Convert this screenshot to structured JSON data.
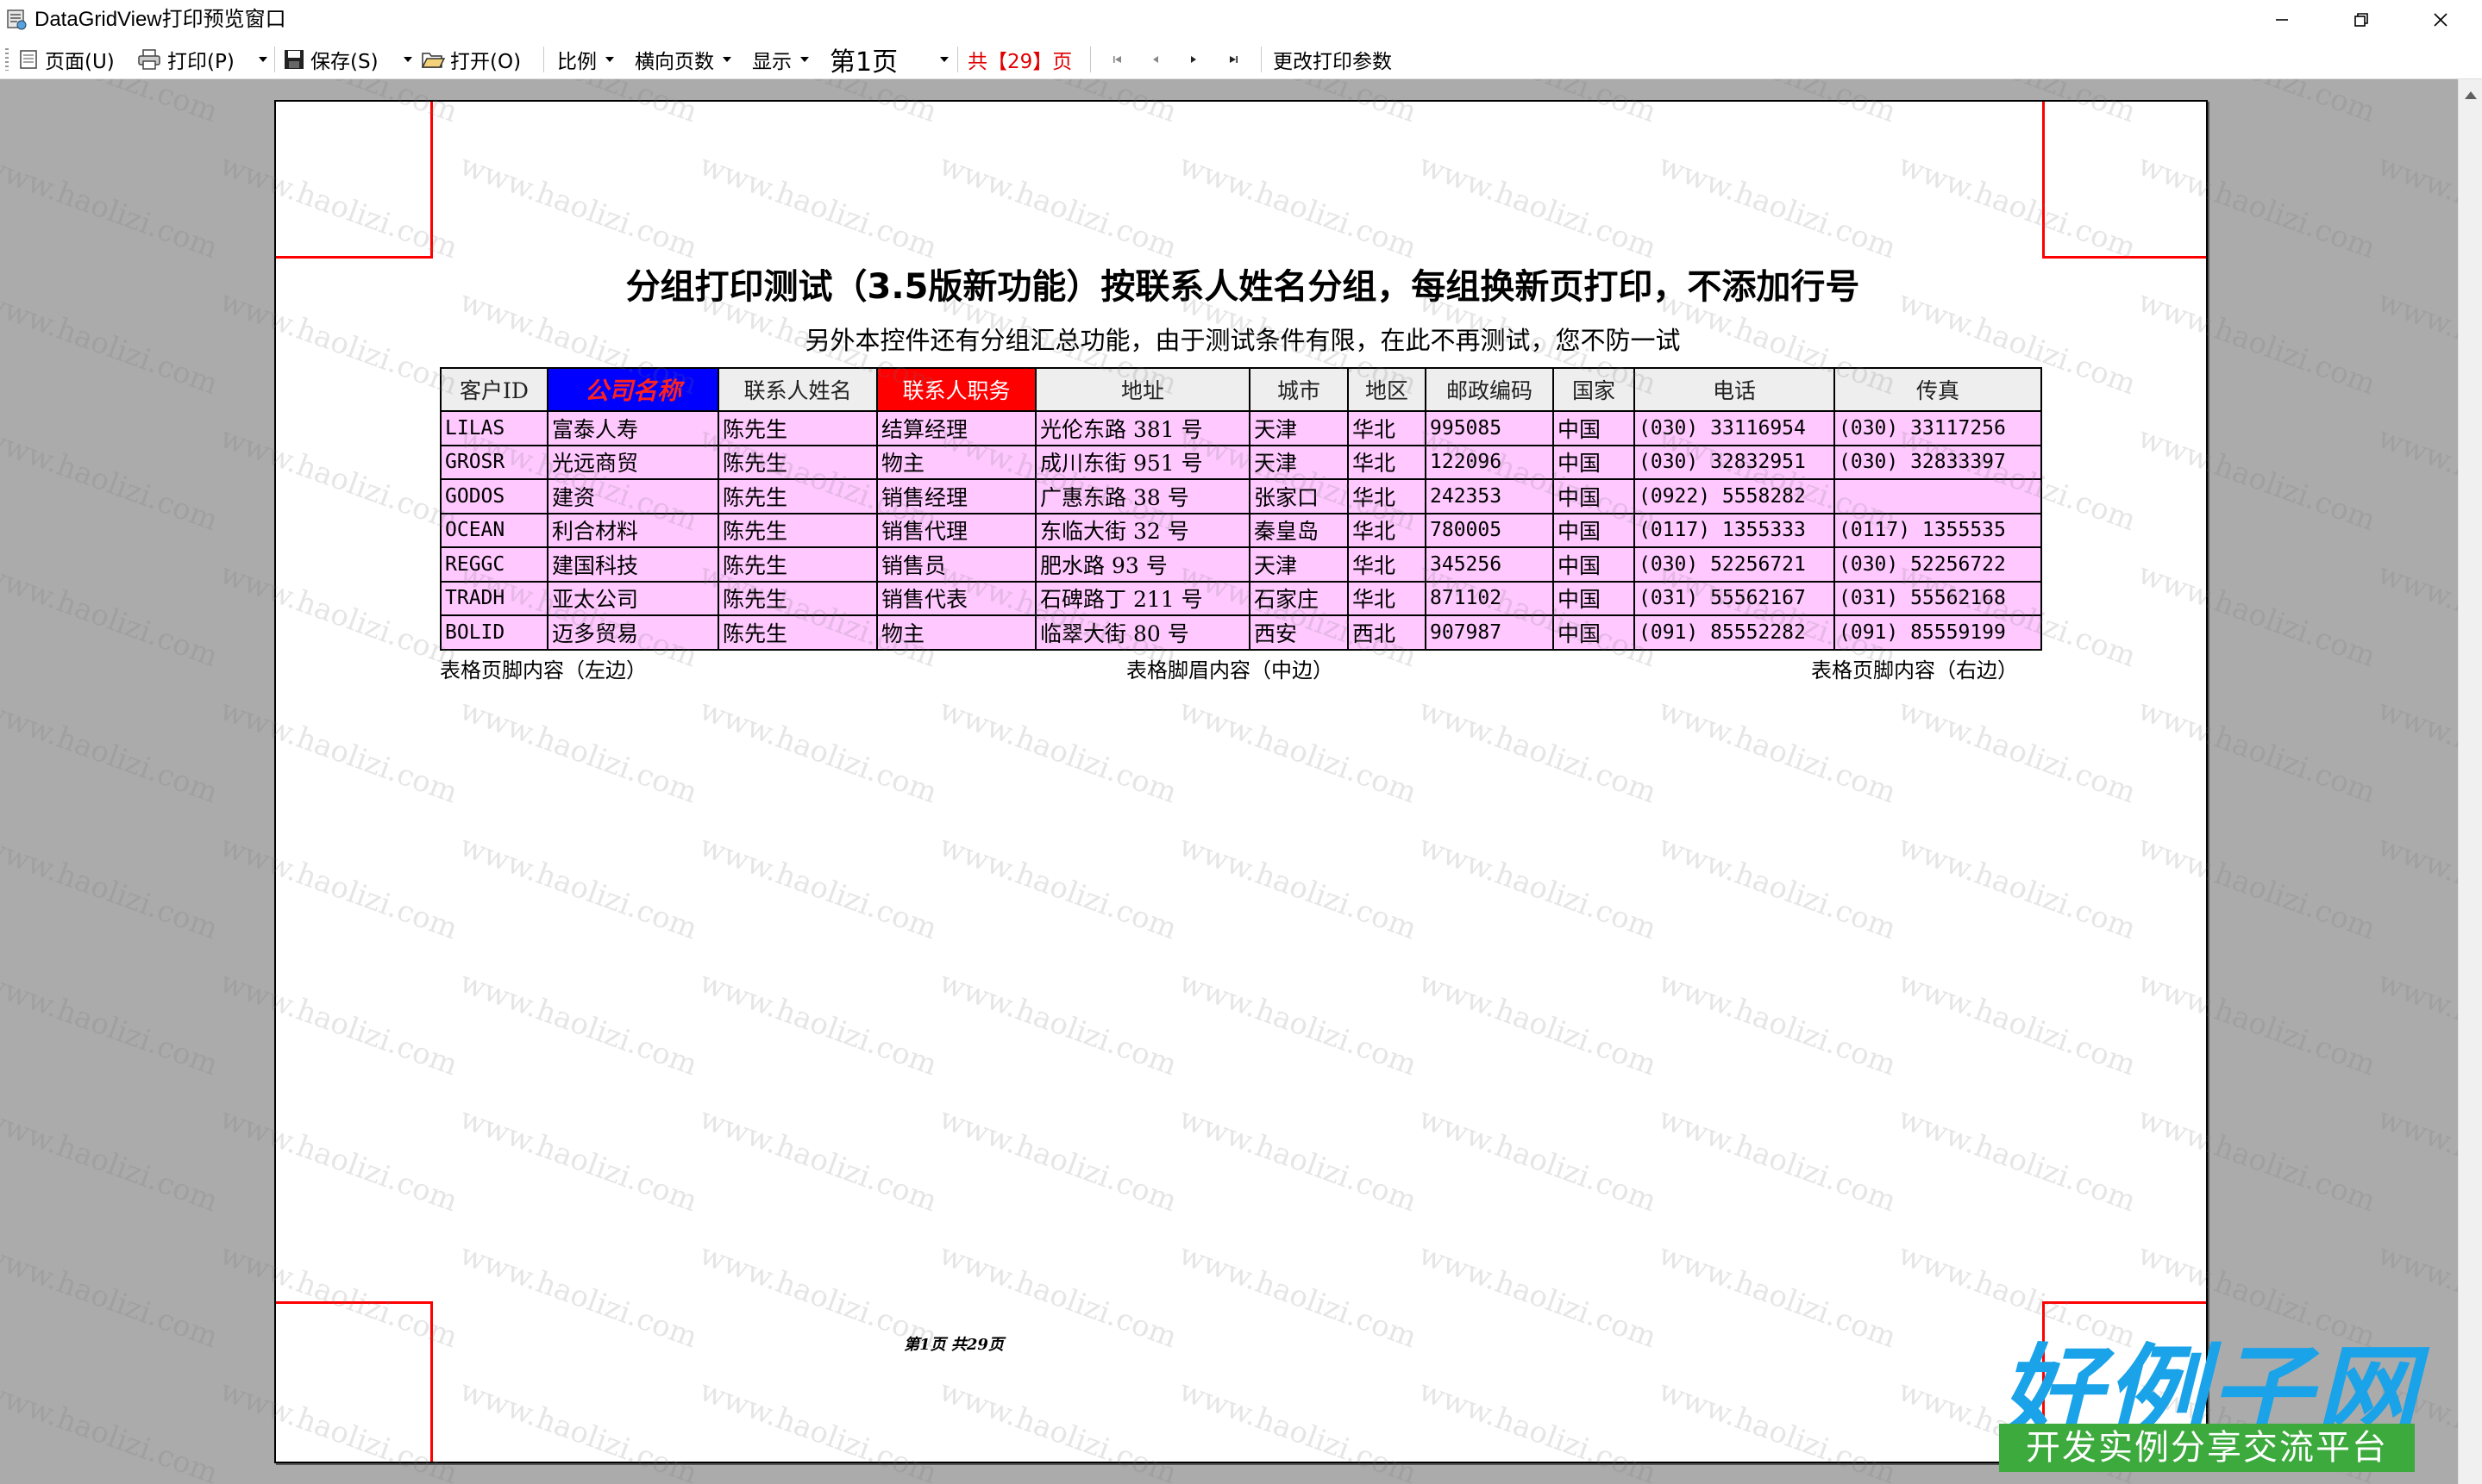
{
  "window": {
    "title": "DataGridView打印预览窗口"
  },
  "toolbar": {
    "page_setup": "页面(U)",
    "print": "打印(P)",
    "save": "保存(S)",
    "open": "打开(O)",
    "scale": "比例",
    "horizontal_pages": "横向页数",
    "display": "显示",
    "current_page": "第1页",
    "total_pages": "共【29】页",
    "change_params": "更改打印参数"
  },
  "report": {
    "title": "分组打印测试（3.5版新功能）按联系人姓名分组，每组换新页打印，不添加行号",
    "subtitle": "另外本控件还有分组汇总功能，由于测试条件有限，在此不再测试，您不防一试",
    "columns": [
      "客户ID",
      "公司名称",
      "联系人姓名",
      "联系人职务",
      "地址",
      "城市",
      "地区",
      "邮政编码",
      "国家",
      "电话",
      "传真"
    ],
    "rows": [
      [
        "LILAS",
        "富泰人寿",
        "陈先生",
        "结算经理",
        "光伦东路 381 号",
        "天津",
        "华北",
        "995085",
        "中国",
        "(030) 33116954",
        "(030) 33117256"
      ],
      [
        "GROSR",
        "光远商贸",
        "陈先生",
        "物主",
        "成川东街 951 号",
        "天津",
        "华北",
        "122096",
        "中国",
        "(030) 32832951",
        "(030) 32833397"
      ],
      [
        "GODOS",
        "建资",
        "陈先生",
        "销售经理",
        "广惠东路 38 号",
        "张家口",
        "华北",
        "242353",
        "中国",
        "(0922) 5558282",
        ""
      ],
      [
        "OCEAN",
        "利合材料",
        "陈先生",
        "销售代理",
        "东临大街 32 号",
        "秦皇岛",
        "华北",
        "780005",
        "中国",
        "(0117) 1355333",
        "(0117) 1355535"
      ],
      [
        "REGGC",
        "建国科技",
        "陈先生",
        "销售员",
        "肥水路 93 号",
        "天津",
        "华北",
        "345256",
        "中国",
        "(030) 52256721",
        "(030) 52256722"
      ],
      [
        "TRADH",
        "亚太公司",
        "陈先生",
        "销售代表",
        "石碑路丁 211 号",
        "石家庄",
        "华北",
        "871102",
        "中国",
        "(031) 55562167",
        "(031) 55562168"
      ],
      [
        "BOLID",
        "迈多贸易",
        "陈先生",
        "物主",
        "临翠大街 80 号",
        "西安",
        "西北",
        "907987",
        "中国",
        "(091) 85552282",
        "(091) 85559199"
      ]
    ],
    "footer_left": "表格页脚内容（左边）",
    "footer_center": "表格脚眉内容（中边）",
    "footer_right": "表格页脚内容（右边）",
    "page_number": "第1页 共29页"
  },
  "watermark_text": "www.haolizi.com",
  "brand": {
    "name": "好例子网",
    "slogan": "开发实例分享交流平台"
  },
  "colors": {
    "cell_bg": "#ffc8ff",
    "header_blue": "#0000ff",
    "header_red": "#ff0000",
    "corner_marks": "#ff0000",
    "brand_blue": "#1aa3e8",
    "brand_green": "#3daa3d"
  },
  "icons": [
    "app-icon",
    "page-setup-icon",
    "printer-icon",
    "save-icon",
    "open-folder-icon",
    "first-page-icon",
    "prev-page-icon",
    "next-page-icon",
    "last-page-icon",
    "minimize-icon",
    "maximize-icon",
    "close-icon"
  ]
}
